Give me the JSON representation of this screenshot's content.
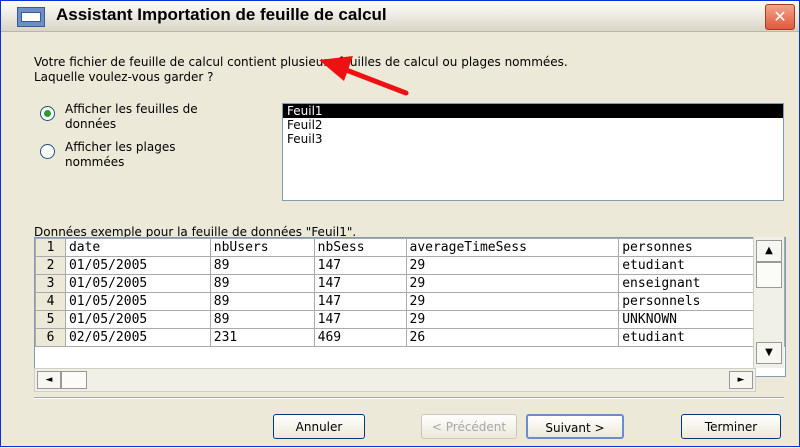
{
  "window": {
    "title": "Assistant Importation de feuille de calcul",
    "close_glyph": "✕"
  },
  "intro": {
    "line1": "Votre fichier de feuille de calcul contient plusieurs feuilles de calcul ou plages nommées.",
    "line2": "Laquelle voulez-vous garder ?"
  },
  "options": [
    {
      "label_line1": "Afficher les feuilles de",
      "label_line2": "données",
      "checked": true
    },
    {
      "label_line1": "Afficher les plages",
      "label_line2": "nommées",
      "checked": false
    }
  ],
  "sheets": [
    "Feuil1",
    "Feuil2",
    "Feuil3"
  ],
  "selected_sheet": "Feuil1",
  "sample": {
    "caption": "Données exemple pour la feuille de données \"Feuil1\".",
    "rows": [
      [
        "1",
        "date",
        "nbUsers",
        "nbSess",
        "averageTimeSess",
        "personnes"
      ],
      [
        "2",
        "01/05/2005",
        "89",
        "147",
        "29",
        "etudiant"
      ],
      [
        "3",
        "01/05/2005",
        "89",
        "147",
        "29",
        "enseignant"
      ],
      [
        "4",
        "01/05/2005",
        "89",
        "147",
        "29",
        "personnels"
      ],
      [
        "5",
        "01/05/2005",
        "89",
        "147",
        "29",
        "UNKNOWN"
      ],
      [
        "6",
        "02/05/2005",
        "231",
        "469",
        "26",
        "etudiant"
      ]
    ]
  },
  "scroll": {
    "up": "▲",
    "down": "▼",
    "left": "◄",
    "right": "►"
  },
  "buttons": {
    "cancel": "Annuler",
    "previous": "< Précédent",
    "next": "Suivant >",
    "finish": "Terminer"
  },
  "colors": {
    "annotation_arrow": "#ee1111",
    "selection": "#000000",
    "radio_checked": "#2f9a2f"
  }
}
